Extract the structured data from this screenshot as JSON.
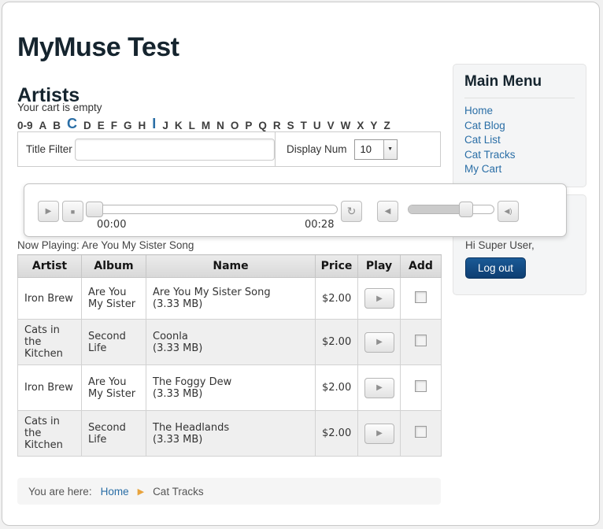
{
  "colors": {
    "link": "#2a6ea6",
    "heading": "#15242e",
    "logout_top": "#1a5a96",
    "logout_bottom": "#0e3e72",
    "logout_border": "#0b3561",
    "crumb_arrow": "#e8a33d"
  },
  "page": {
    "site_title": "MyMuse Test",
    "section_heading": "Artists"
  },
  "cart": {
    "status": "Your cart is empty"
  },
  "alpha_filter": {
    "letters": [
      "0-9",
      "A",
      "B",
      "C",
      "D",
      "E",
      "F",
      "G",
      "H",
      "I",
      "J",
      "K",
      "L",
      "M",
      "N",
      "O",
      "P",
      "Q",
      "R",
      "S",
      "T",
      "U",
      "V",
      "W",
      "X",
      "Y",
      "Z"
    ],
    "active": [
      "C",
      "I"
    ]
  },
  "filter_bar": {
    "title_filter_label": "Title Filter",
    "title_filter_value": "",
    "display_num_label": "Display Num",
    "display_num_value": "10"
  },
  "player": {
    "time_current": "00:00",
    "time_total": "00:28",
    "play_icon": "▶",
    "stop_icon": "■",
    "loop_icon": "↻",
    "mute_icon": "◀",
    "volume_icon": "◀)"
  },
  "now_playing": "Now Playing: Are You My Sister Song",
  "table": {
    "columns": [
      "Artist",
      "Album",
      "Name",
      "Price",
      "Play",
      "Add"
    ],
    "rows": [
      {
        "artist": "Iron Brew",
        "album": "Are You My Sister",
        "name": "Are You My Sister Song",
        "size": "(3.33 MB)",
        "price": "$2.00"
      },
      {
        "artist": "Cats in the Kitchen",
        "album": "Second Life",
        "name": "Coonla",
        "size": "(3.33 MB)",
        "price": "$2.00"
      },
      {
        "artist": "Iron Brew",
        "album": "Are You My Sister",
        "name": "The Foggy Dew",
        "size": "(3.33 MB)",
        "price": "$2.00"
      },
      {
        "artist": "Cats in the Kitchen",
        "album": "Second Life",
        "name": "The Headlands",
        "size": "(3.33 MB)",
        "price": "$2.00"
      }
    ]
  },
  "sidebar": {
    "menu_title": "Main Menu",
    "items": [
      "Home",
      "Cat Blog",
      "Cat List",
      "Cat Tracks",
      "My Cart"
    ],
    "greeting": "Hi Super User,",
    "logout_label": "Log out"
  },
  "breadcrumb": {
    "prefix": "You are here:",
    "home": "Home",
    "current": "Cat Tracks"
  }
}
